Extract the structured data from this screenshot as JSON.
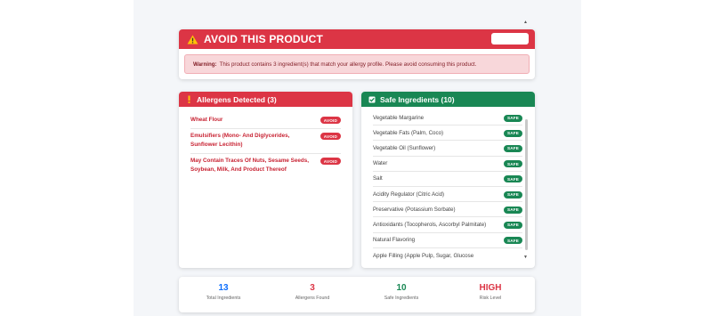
{
  "alert": {
    "title": "AVOID THIS PRODUCT",
    "warning_label": "Warning:",
    "warning_text": "This product contains 3 ingredient(s) that match your allergy profile. Please avoid consuming this product."
  },
  "allergens": {
    "title": "Allergens Detected (3)",
    "items": [
      {
        "name": "Wheat Flour",
        "badge": "AVOID"
      },
      {
        "name": "Emulsifiers (Mono- And Diglycerides, Sunflower Lecithin)",
        "badge": "AVOID"
      },
      {
        "name": "May Contain Traces Of Nuts, Sesame Seeds, Soybean, Milk, And Product Thereof",
        "badge": "AVOID"
      }
    ]
  },
  "safe": {
    "title": "Safe Ingredients (10)",
    "items": [
      {
        "name": "Vegetable Margarine",
        "badge": "SAFE"
      },
      {
        "name": "Vegetable Fats (Palm, Coco)",
        "badge": "SAFE"
      },
      {
        "name": "Vegetable Oil (Sunflower)",
        "badge": "SAFE"
      },
      {
        "name": "Water",
        "badge": "SAFE"
      },
      {
        "name": "Salt",
        "badge": "SAFE"
      },
      {
        "name": "Acidity Regulator (Citric Acid)",
        "badge": "SAFE"
      },
      {
        "name": "Preservative (Potassium Sorbate)",
        "badge": "SAFE"
      },
      {
        "name": "Antioxidants (Tocopherols, Ascorbyl Palmitate)",
        "badge": "SAFE"
      },
      {
        "name": "Natural Flavoring",
        "badge": "SAFE"
      },
      {
        "name": "Apple Filling (Apple Pulp, Sugar, Glucose",
        "badge": ""
      }
    ]
  },
  "stats": [
    {
      "value": "13",
      "label": "Total Ingredients",
      "color": "#0d6efd"
    },
    {
      "value": "3",
      "label": "Allergens Found",
      "color": "#dc3545"
    },
    {
      "value": "10",
      "label": "Safe Ingredients",
      "color": "#198754"
    },
    {
      "value": "HIGH",
      "label": "Risk Level",
      "color": "#dc3545"
    }
  ],
  "colors": {
    "danger": "#dc3545",
    "success": "#198754",
    "primary": "#0d6efd"
  }
}
